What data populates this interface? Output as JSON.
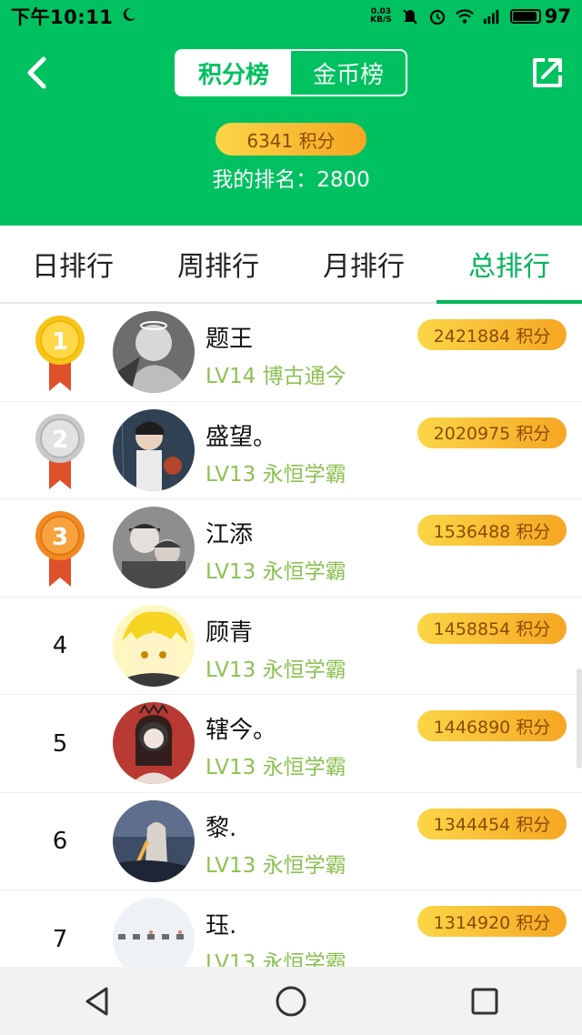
{
  "status_bar": {
    "time": "下午10:11",
    "net_speed_value": "0.03",
    "net_speed_unit": "KB/S",
    "battery": "97"
  },
  "header": {
    "tabs": [
      {
        "label": "积分榜",
        "active": true
      },
      {
        "label": "金币榜",
        "active": false
      }
    ],
    "my_points": "6341 积分",
    "my_rank": "我的排名：2800"
  },
  "period_tabs": [
    {
      "label": "日排行",
      "active": false
    },
    {
      "label": "周排行",
      "active": false
    },
    {
      "label": "月排行",
      "active": false
    },
    {
      "label": "总排行",
      "active": true
    }
  ],
  "leaderboard": [
    {
      "rank": "1",
      "medal": "gold",
      "name": "题王",
      "level": "LV14 博古通今",
      "points": "2421884 积分"
    },
    {
      "rank": "2",
      "medal": "silver",
      "name": "盛望。",
      "level": "LV13 永恒学霸",
      "points": "2020975 积分"
    },
    {
      "rank": "3",
      "medal": "bronze",
      "name": "江添",
      "level": "LV13 永恒学霸",
      "points": "1536488 积分"
    },
    {
      "rank": "4",
      "medal": "",
      "name": "顾青",
      "level": "LV13 永恒学霸",
      "points": "1458854 积分"
    },
    {
      "rank": "5",
      "medal": "",
      "name": "辖今。",
      "level": "LV13 永恒学霸",
      "points": "1446890 积分"
    },
    {
      "rank": "6",
      "medal": "",
      "name": "黎.",
      "level": "LV13 永恒学霸",
      "points": "1344454 积分"
    },
    {
      "rank": "7",
      "medal": "",
      "name": "珏.",
      "level": "LV13 永恒学霸",
      "points": "1314920 积分"
    }
  ],
  "colors": {
    "brand_green": "#00c160",
    "tab_active": "#00b35a",
    "level_text": "#8cc152",
    "points_pill_start": "#fbd647",
    "points_pill_end": "#f6a623",
    "gold_medal": "#f5c518",
    "silver_medal": "#c9c9c9",
    "bronze_medal": "#f08a24",
    "ribbon": "#e0502a"
  },
  "icons": {
    "back": "back-arrow-icon",
    "share": "share-icon",
    "nav_back": "triangle-back-icon",
    "nav_home": "circle-home-icon",
    "nav_recents": "square-recents-icon"
  }
}
